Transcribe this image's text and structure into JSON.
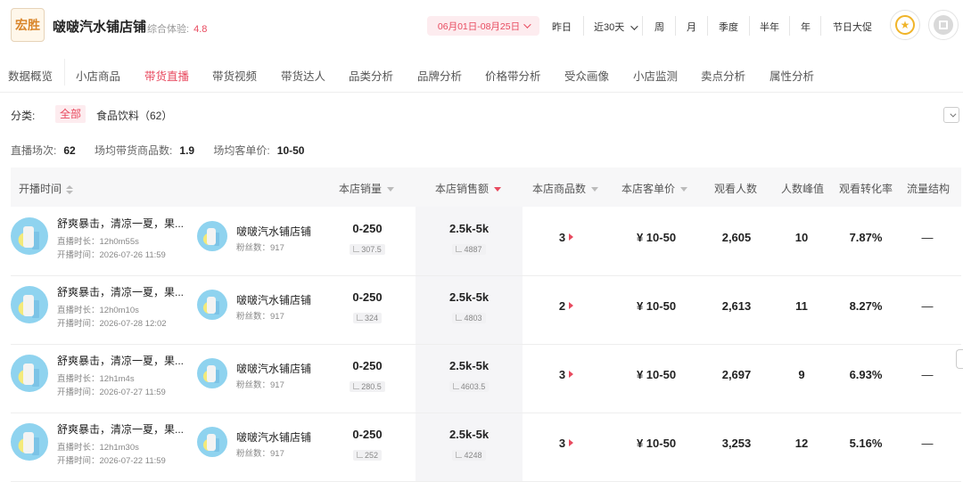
{
  "header": {
    "logo_text": "宏胜",
    "shop_name": "啵啵汽水铺店铺",
    "rating_label": "综合体验:",
    "rating_value": "4.8",
    "date_range": "06月01日-08月25日",
    "periods": [
      "昨日",
      "近30天",
      "周",
      "月",
      "季度",
      "半年",
      "年",
      "节日大促"
    ]
  },
  "nav": {
    "tabs": [
      "数据概览",
      "小店商品",
      "带货直播",
      "带货视频",
      "带货达人",
      "品类分析",
      "品牌分析",
      "价格带分析",
      "受众画像",
      "小店监测",
      "卖点分析",
      "属性分析"
    ],
    "active": "带货直播"
  },
  "filter": {
    "label": "分类:",
    "all": "全部",
    "category": "食品饮料（62）"
  },
  "stats": {
    "sessions_label": "直播场次:",
    "sessions_value": "62",
    "avg_products_label": "场均带货商品数:",
    "avg_products_value": "1.9",
    "avg_price_label": "场均客单价:",
    "avg_price_value": "10-50"
  },
  "table": {
    "columns": [
      "开播时间",
      "本店销量",
      "本店销售额",
      "本店商品数",
      "本店客单价",
      "观看人数",
      "人数峰值",
      "观看转化率",
      "流量结构"
    ],
    "rows": [
      {
        "title": "舒爽暴击，清凉一夏，果...",
        "duration": "直播时长：12h0m55s",
        "start": "开播时间：2026-07-26 11:59",
        "anchor": "啵啵汽水铺店铺",
        "fans": "粉丝数：917",
        "sales_range": "0-250",
        "sales_exact": "307.5",
        "revenue_range": "2.5k-5k",
        "revenue_exact": "4887",
        "products": "3",
        "unit_price": "¥ 10-50",
        "viewers": "2,605",
        "peak": "10",
        "conversion": "7.87%",
        "traffic": "—"
      },
      {
        "title": "舒爽暴击，清凉一夏，果...",
        "duration": "直播时长：12h0m10s",
        "start": "开播时间：2026-07-28 12:02",
        "anchor": "啵啵汽水铺店铺",
        "fans": "粉丝数：917",
        "sales_range": "0-250",
        "sales_exact": "324",
        "revenue_range": "2.5k-5k",
        "revenue_exact": "4803",
        "products": "2",
        "unit_price": "¥ 10-50",
        "viewers": "2,613",
        "peak": "11",
        "conversion": "8.27%",
        "traffic": "—"
      },
      {
        "title": "舒爽暴击，清凉一夏，果...",
        "duration": "直播时长：12h1m4s",
        "start": "开播时间：2026-07-27 11:59",
        "anchor": "啵啵汽水铺店铺",
        "fans": "粉丝数：917",
        "sales_range": "0-250",
        "sales_exact": "280.5",
        "revenue_range": "2.5k-5k",
        "revenue_exact": "4603.5",
        "products": "3",
        "unit_price": "¥ 10-50",
        "viewers": "2,697",
        "peak": "9",
        "conversion": "6.93%",
        "traffic": "—"
      },
      {
        "title": "舒爽暴击，清凉一夏，果...",
        "duration": "直播时长：12h1m30s",
        "start": "开播时间：2026-07-22 11:59",
        "anchor": "啵啵汽水铺店铺",
        "fans": "粉丝数：917",
        "sales_range": "0-250",
        "sales_exact": "252",
        "revenue_range": "2.5k-5k",
        "revenue_exact": "4248",
        "products": "3",
        "unit_price": "¥ 10-50",
        "viewers": "3,253",
        "peak": "12",
        "conversion": "5.16%",
        "traffic": "—"
      }
    ]
  },
  "colors": {
    "accent": "#e84a5f",
    "accent_bg": "#fdecef",
    "star": "#f0b429"
  },
  "icons": [
    "chevron-down-icon",
    "star-icon",
    "qr-code-icon",
    "sort-icon",
    "bar-chart-icon",
    "expand-triangle-icon"
  ]
}
